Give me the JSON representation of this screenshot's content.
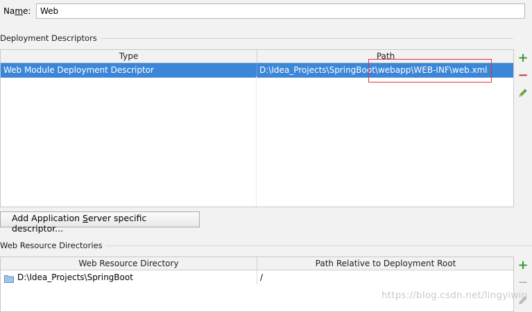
{
  "name_field": {
    "label_prefix": "Na",
    "label_mnemonic": "m",
    "label_suffix": "e:",
    "value": "Web"
  },
  "deployment_descriptors": {
    "section_title": "Deployment Descriptors",
    "columns": {
      "type": "Type",
      "path": "Path"
    },
    "rows": [
      {
        "type": "Web Module Deployment Descriptor",
        "path": "D:\\Idea_Projects\\SpringBoot\\webapp\\WEB-INF\\web.xml"
      }
    ],
    "toolbar": {
      "add_icon": "plus-icon",
      "remove_icon": "minus-icon",
      "edit_icon": "pencil-icon"
    }
  },
  "add_server_descriptor_button": {
    "label_prefix": "Add Application ",
    "label_mnemonic": "S",
    "label_suffix": "erver specific descriptor..."
  },
  "web_resource_directories": {
    "section_title": "Web Resource Directories",
    "columns": {
      "directory": "Web Resource Directory",
      "relative_path": "Path Relative to Deployment Root"
    },
    "rows": [
      {
        "directory": "D:\\Idea_Projects\\SpringBoot",
        "relative_path": "/",
        "icon": "folder-icon"
      }
    ],
    "toolbar": {
      "add_icon": "plus-icon",
      "remove_icon": "minus-icon",
      "edit_icon": "pencil-icon"
    }
  },
  "watermark": "https://blog.csdn.net/lingyiwin",
  "colors": {
    "selection": "#3c86d7",
    "highlight_box": "#e0353a",
    "add": "#3a9b3a",
    "remove": "#d03b3b"
  }
}
